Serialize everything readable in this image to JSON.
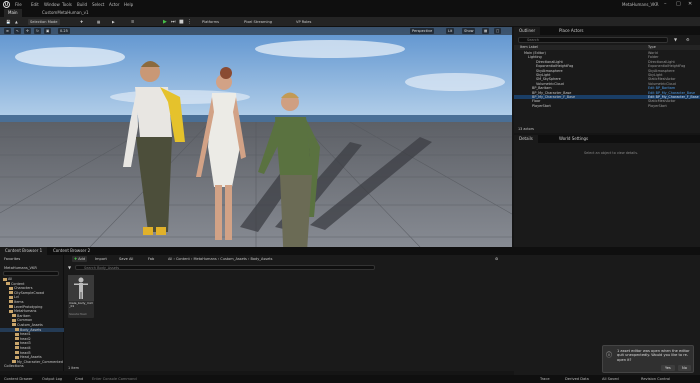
{
  "titlebar": {
    "menus": [
      "File",
      "Edit",
      "Window",
      "Tools",
      "Build",
      "Select",
      "Actor",
      "Help"
    ],
    "project_name": "MetaHumans_VKR"
  },
  "tabs": [
    {
      "label": "Main"
    },
    {
      "label": "CustomMetaHuman_v1"
    }
  ],
  "toolbar": {
    "mode": "Selection Mode",
    "platforms": "Platforms",
    "pixel_streaming": "Pixel Streaming",
    "vr_roles": "VP Roles"
  },
  "viewport": {
    "perspective": "Perspective",
    "lit": "Lit",
    "show": "Show",
    "fov_value": "0.25"
  },
  "outliner": {
    "title": "Outliner",
    "place_actors": "Place Actors",
    "search_placeholder": "Search",
    "col_label": "Item Label",
    "col_type": "Type",
    "rows": [
      {
        "label": "Main (Editor)",
        "type": "World"
      },
      {
        "label": "Lighting",
        "type": "Folder"
      },
      {
        "label": "DirectionalLight",
        "type": "DirectionalLight"
      },
      {
        "label": "ExponentialHeightFog",
        "type": "ExponentialHeightFog"
      },
      {
        "label": "SkyAtmosphere",
        "type": "SkyAtmosphere"
      },
      {
        "label": "SkyLight",
        "type": "SkyLight"
      },
      {
        "label": "SM_SkySphere",
        "type": "StaticMeshActor"
      },
      {
        "label": "VolumetricCloud",
        "type": "VolumetricCloud"
      },
      {
        "label": "BP_Baritam",
        "type": "Edit BP_Baritam"
      },
      {
        "label": "BP_My_Character_Base",
        "type": "Edit BP_My_Character_Base"
      },
      {
        "label": "BP_My_Character_F_Base",
        "type": "Edit BP_My_Character_F_Base"
      },
      {
        "label": "Floor",
        "type": "StaticMeshActor"
      },
      {
        "label": "PlayerStart",
        "type": "PlayerStart"
      }
    ],
    "count": "13 actors"
  },
  "details": {
    "title": "Details",
    "world_settings": "World Settings",
    "empty_message": "Select an object to view details."
  },
  "content_browser": {
    "tab1": "Content Browser 1",
    "tab2": "Content Browser 2",
    "add": "Add",
    "import": "Import",
    "save_all": "Save All",
    "fab": "Fab",
    "settings": "Settings",
    "favorites": "Favorites",
    "project": "MetaHumans_VKR",
    "search_placeholder": "Search Body_Assets",
    "path": [
      "All",
      "Content",
      "MetaHumans",
      "Custom_Assets",
      "Body_Assets"
    ],
    "folders": [
      {
        "label": "All",
        "indent": 0
      },
      {
        "label": "Content",
        "indent": 1
      },
      {
        "label": "Characters",
        "indent": 2
      },
      {
        "label": "CitySampleCrowd",
        "indent": 2
      },
      {
        "label": "Lvl",
        "indent": 2
      },
      {
        "label": "Items",
        "indent": 2
      },
      {
        "label": "LevelPrototyping",
        "indent": 2
      },
      {
        "label": "MetaHumans",
        "indent": 2
      },
      {
        "label": "Baritam",
        "indent": 3
      },
      {
        "label": "Common",
        "indent": 3
      },
      {
        "label": "Custom_Assets",
        "indent": 3
      },
      {
        "label": "Body_Assets",
        "indent": 4
      },
      {
        "label": "head1",
        "indent": 4
      },
      {
        "label": "head2",
        "indent": 4
      },
      {
        "label": "head3",
        "indent": 4
      },
      {
        "label": "head4",
        "indent": 4
      },
      {
        "label": "head5",
        "indent": 4
      },
      {
        "label": "Head_Assets",
        "indent": 4
      },
      {
        "label": "My_Character_Commented",
        "indent": 3
      }
    ],
    "asset_name": "male_body_mid_01",
    "asset_type": "Skeletal Mesh",
    "item_count": "1 item",
    "collections": "Collections"
  },
  "statusbar": {
    "content_drawer": "Content Drawer",
    "output_log": "Output Log",
    "cmd": "Cmd",
    "console_placeholder": "Enter Console Command",
    "trace": "Trace",
    "derived_data": "Derived Data",
    "unsaved": "All Saved",
    "revision_control": "Revision Control"
  },
  "toast": {
    "message": "1 asset editor was open when the editor quit unexpectedly. Would you like to re-open it?",
    "yes": "Yes",
    "no": "No"
  }
}
